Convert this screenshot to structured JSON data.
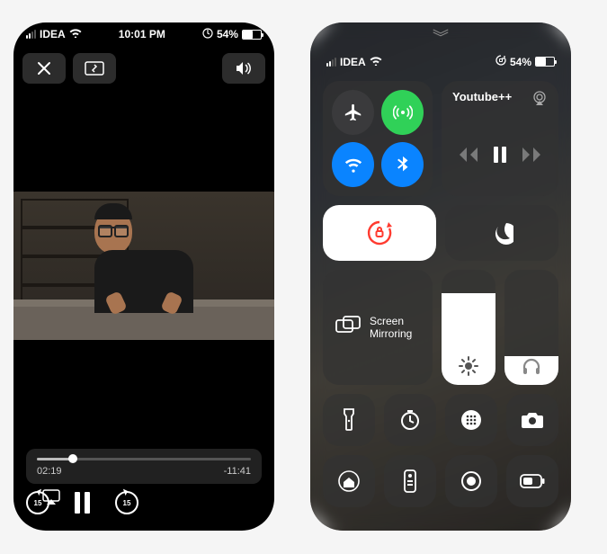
{
  "status": {
    "carrier": "IDEA",
    "time": "10:01 PM",
    "battery_pct": "54%"
  },
  "player": {
    "elapsed": "02:19",
    "remaining": "-11:41",
    "progress_pct": 17,
    "skip_seconds": "15"
  },
  "cc": {
    "carrier": "IDEA",
    "battery_pct": "54%",
    "now_playing": "Youtube++",
    "mirror_label": "Screen Mirroring",
    "brightness_pct": 80,
    "volume_pct": 25,
    "connectivity": {
      "airplane": false,
      "cellular": true,
      "wifi": true,
      "bluetooth": true
    },
    "orientation_locked": true,
    "dnd": false
  }
}
